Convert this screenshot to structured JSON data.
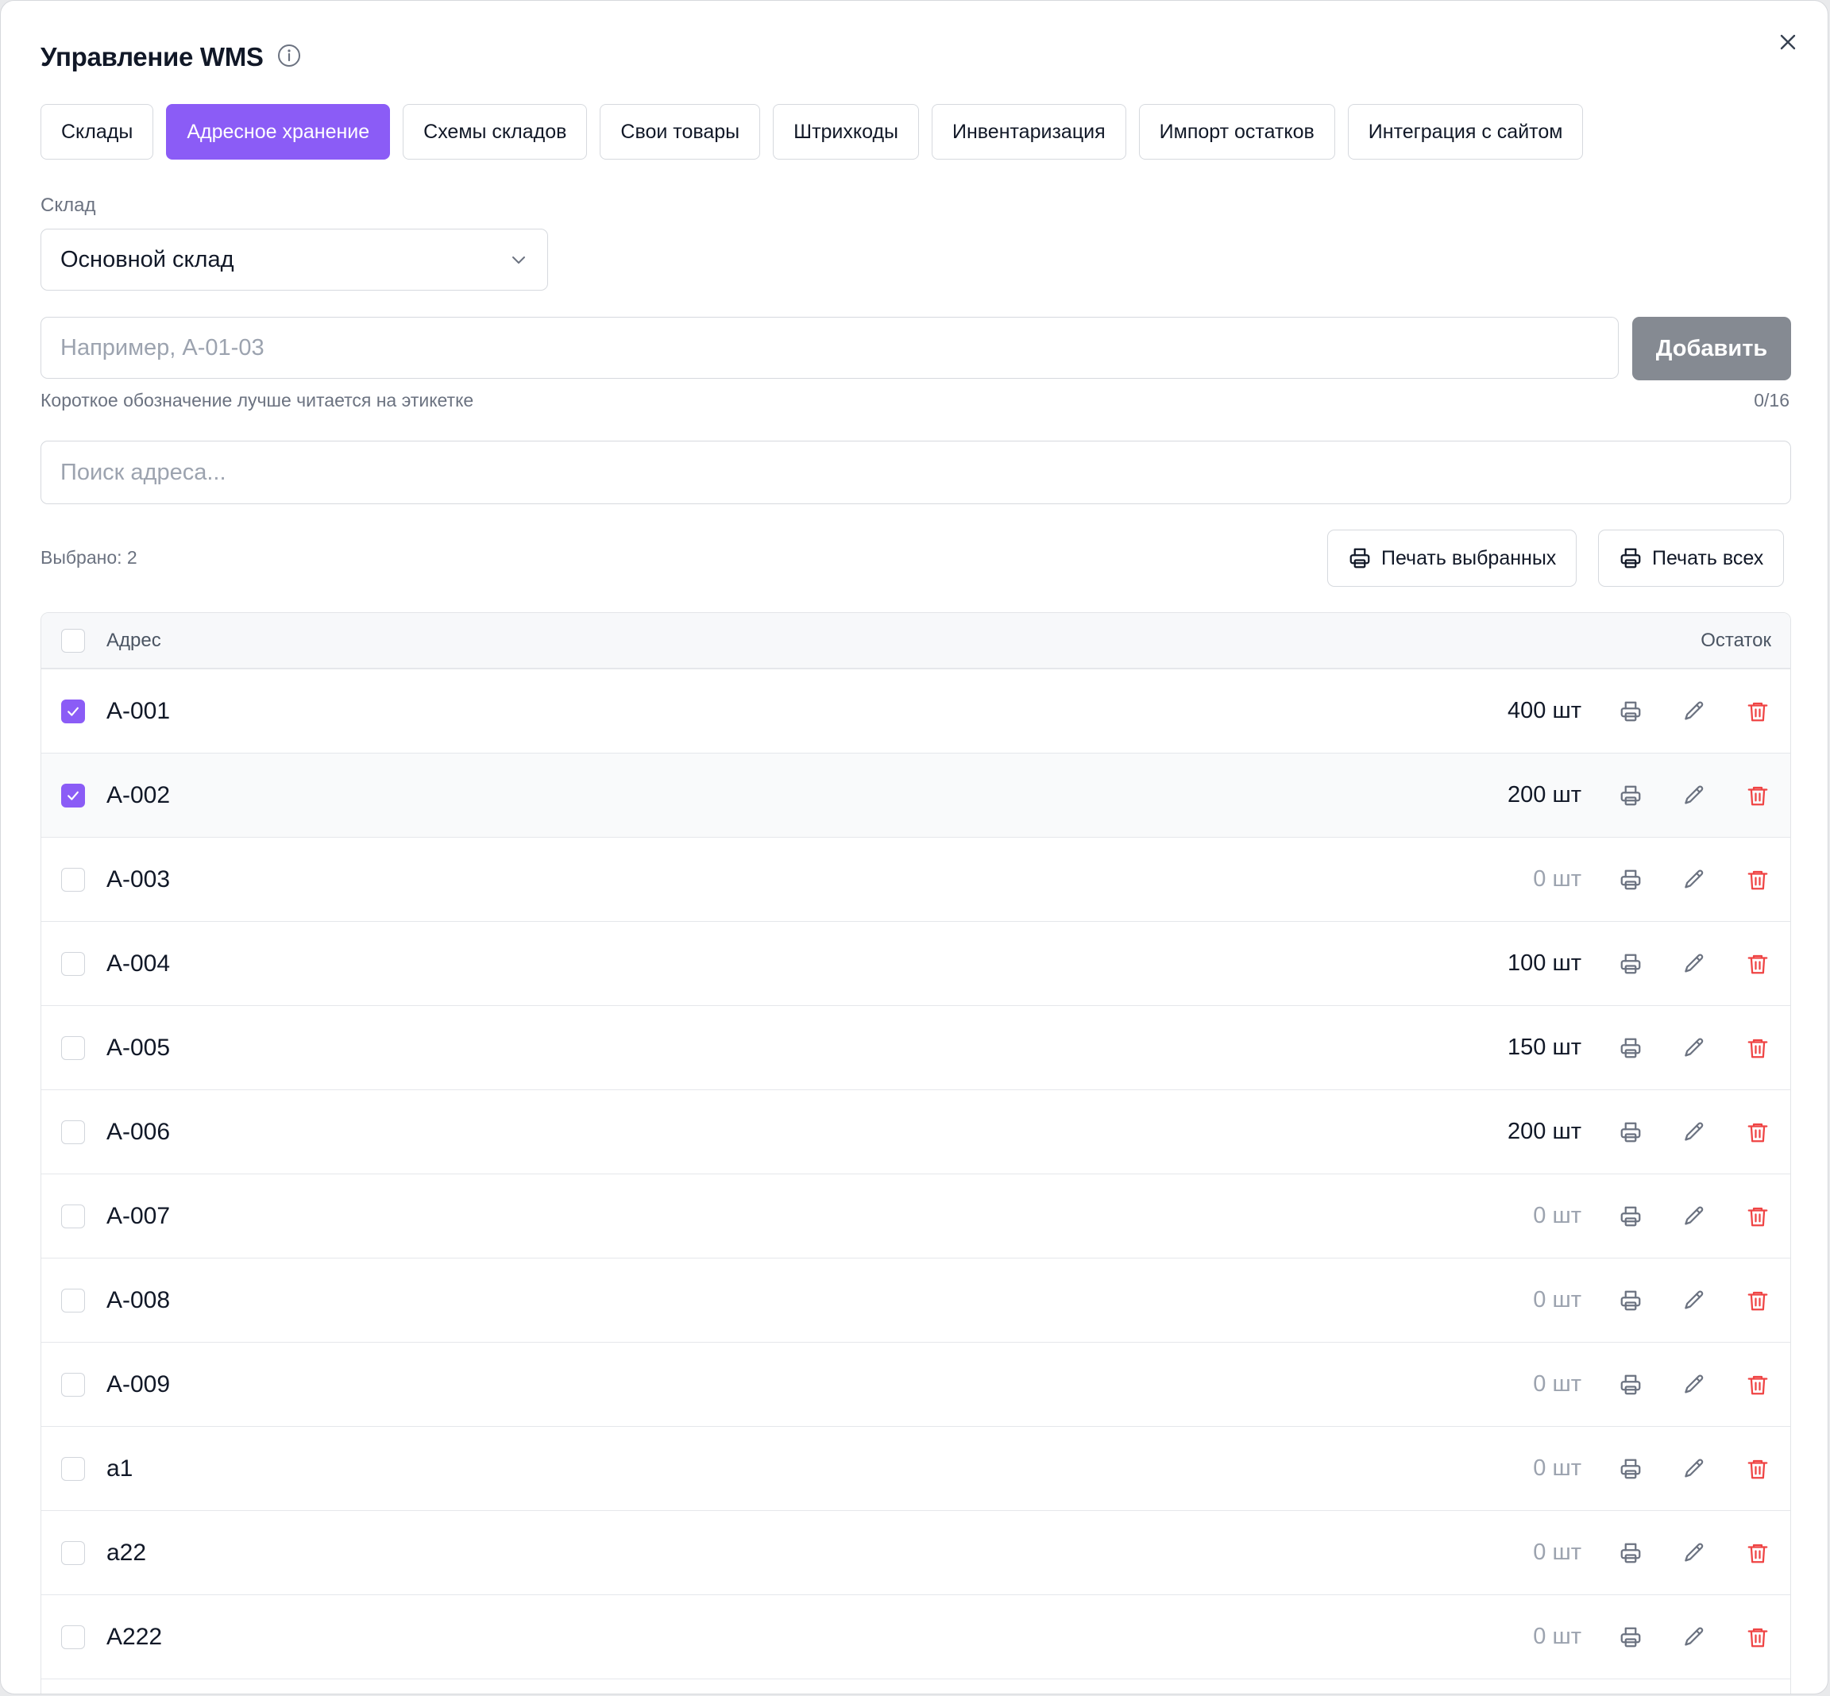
{
  "modal": {
    "title": "Управление WMS",
    "close_icon": "close-icon",
    "info_icon": "info-icon"
  },
  "tabs": [
    {
      "label": "Склады",
      "active": false
    },
    {
      "label": "Адресное хранение",
      "active": true
    },
    {
      "label": "Схемы складов",
      "active": false
    },
    {
      "label": "Свои товары",
      "active": false
    },
    {
      "label": "Штрихкоды",
      "active": false
    },
    {
      "label": "Инвентаризация",
      "active": false
    },
    {
      "label": "Импорт остатков",
      "active": false
    },
    {
      "label": "Интеграция с сайтом",
      "active": false
    }
  ],
  "warehouse": {
    "label": "Склад",
    "selected": "Основной склад"
  },
  "add_form": {
    "placeholder": "Например, А-01-03",
    "value": "",
    "button_label": "Добавить",
    "hint": "Короткое обозначение лучше читается на этикетке",
    "counter": "0/16"
  },
  "search": {
    "placeholder": "Поиск адреса...",
    "value": ""
  },
  "selection": {
    "text": "Выбрано: 2",
    "print_selected_label": "Печать выбранных",
    "print_all_label": "Печать всех"
  },
  "table": {
    "columns": {
      "address": "Адрес",
      "stock": "Остаток"
    },
    "rows": [
      {
        "address": "A-001",
        "stock": "400 шт",
        "checked": true
      },
      {
        "address": "A-002",
        "stock": "200 шт",
        "checked": true
      },
      {
        "address": "A-003",
        "stock": "0 шт",
        "checked": false
      },
      {
        "address": "A-004",
        "stock": "100 шт",
        "checked": false
      },
      {
        "address": "A-005",
        "stock": "150 шт",
        "checked": false
      },
      {
        "address": "A-006",
        "stock": "200 шт",
        "checked": false
      },
      {
        "address": "A-007",
        "stock": "0 шт",
        "checked": false
      },
      {
        "address": "A-008",
        "stock": "0 шт",
        "checked": false
      },
      {
        "address": "A-009",
        "stock": "0 шт",
        "checked": false
      },
      {
        "address": "a1",
        "stock": "0 шт",
        "checked": false
      },
      {
        "address": "a22",
        "stock": "0 шт",
        "checked": false
      },
      {
        "address": "A222",
        "stock": "0 шт",
        "checked": false
      }
    ]
  },
  "colors": {
    "accent": "#8b5cf6",
    "danger": "#ef4444",
    "muted": "#9ca3af",
    "button_disabled": "#858a92"
  }
}
